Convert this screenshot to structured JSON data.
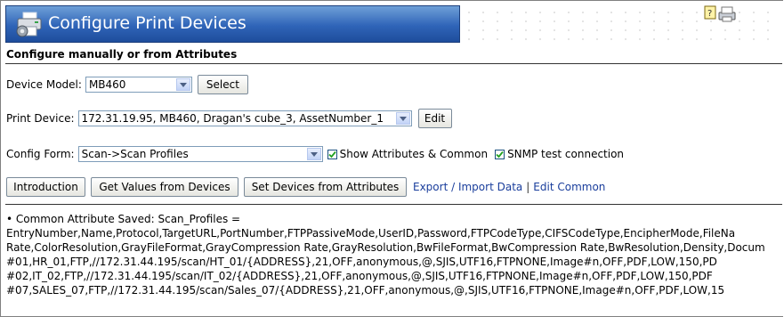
{
  "header": {
    "title": "Configure Print Devices",
    "subtitle": "Configure manually or from Attributes",
    "banner_color": "#2f64b8"
  },
  "device_model": {
    "label": "Device Model:",
    "value": "MB460",
    "select_button": "Select"
  },
  "print_device": {
    "label": "Print Device:",
    "value": "172.31.19.95, MB460, Dragan's cube_3, AssetNumber_1",
    "edit_button": "Edit"
  },
  "config_form": {
    "label": "Config Form:",
    "value": "Scan->Scan Profiles",
    "show_attributes_label": "Show Attributes & Common",
    "show_attributes_checked": true,
    "snmp_label": "SNMP test connection",
    "snmp_checked": true
  },
  "actions": {
    "introduction": "Introduction",
    "get_values": "Get Values from Devices",
    "set_devices": "Set Devices from Attributes",
    "export_import": "Export / Import Data",
    "separator": "|",
    "edit_common": "Edit Common"
  },
  "result": {
    "heading": "• Common Attribute Saved: Scan_Profiles =",
    "lines": [
      "EntryNumber,Name,Protocol,TargetURL,PortNumber,FTPPassiveMode,UserID,Password,FTPCodeType,CIFSCodeType,EncipherMode,FileNa",
      "Rate,ColorResolution,GrayFileFormat,GrayCompression Rate,GrayResolution,BwFileFormat,BwCompression Rate,BwResolution,Density,Docum",
      "#01,HR_01,FTP,//172.31.44.195/scan/HT_01/{ADDRESS},21,OFF,anonymous,@,SJIS,UTF16,FTPNONE,Image#n,OFF,PDF,LOW,150,PD",
      "#02,IT_02,FTP,//172.31.44.195/scan/IT_02/{ADDRESS},21,OFF,anonymous,@,SJIS,UTF16,FTPNONE,Image#n,OFF,PDF,LOW,150,PDF",
      "#07,SALES_07,FTP,//172.31.44.195/scan/Sales_07/{ADDRESS},21,OFF,anonymous,@,SJIS,UTF16,FTPNONE,Image#n,OFF,PDF,LOW,15"
    ]
  }
}
